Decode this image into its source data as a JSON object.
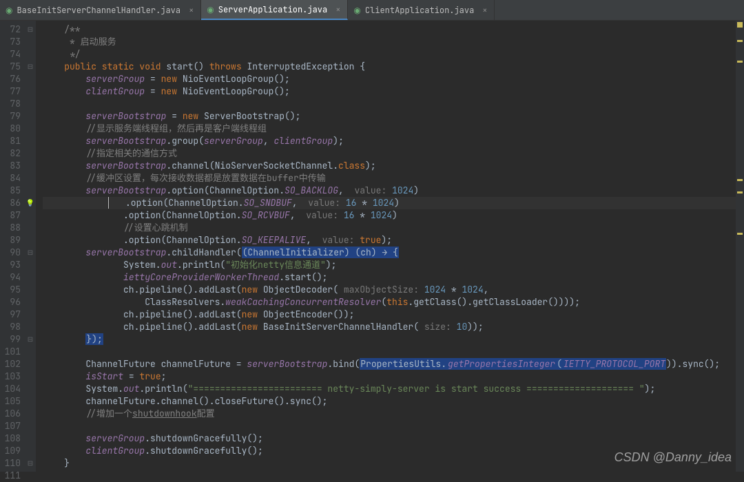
{
  "tabs": [
    {
      "label": "BaseInitServerChannelHandler.java",
      "active": false
    },
    {
      "label": "ServerApplication.java",
      "active": true
    },
    {
      "label": "ClientApplication.java",
      "active": false
    }
  ],
  "watermark": "CSDN @Danny_idea",
  "line_numbers": [
    "72",
    "73",
    "74",
    "75",
    "76",
    "77",
    "78",
    "79",
    "80",
    "81",
    "82",
    "83",
    "84",
    "85",
    "86",
    "87",
    "88",
    "89",
    "90",
    "93",
    "94",
    "95",
    "96",
    "97",
    "98",
    "99",
    "101",
    "102",
    "103",
    "104",
    "105",
    "106",
    "107",
    "108",
    "109",
    "110",
    "111"
  ],
  "current_line": "86",
  "code": {
    "l72": "/**",
    "l73": " * 启动服务",
    "l74": " */",
    "l75_kw1": "public static void",
    "l75_name": "start",
    "l75_throws": "throws",
    "l75_ex": "InterruptedException",
    "l76_field": "serverGroup",
    "l76_new": "new",
    "l76_ctor": "NioEventLoopGroup",
    "l77_field": "clientGroup",
    "l79_field": "serverBootstrap",
    "l79_ctor": "ServerBootstrap",
    "l80_cmt": "//显示服务端线程组，然后再是客户端线程组",
    "l81_call": ".group(",
    "l81_a": "serverGroup",
    "l81_b": "clientGroup",
    "l82_cmt": "//指定相关的通信方式",
    "l83_call": ".channel(NioServerSocketChannel.",
    "l83_kw": "class",
    "l84_cmt": "//缓冲区设置，每次接收数据都是放置数据在buffer中传输",
    "l85_call": ".option(ChannelOption.",
    "l85_c": "SO_BACKLOG",
    "l85_hint": "value:",
    "l85_val": "1024",
    "l86_c": "SO_SNDBUF",
    "l86_hint": "value:",
    "l86_v1": "16",
    "l86_v2": "1024",
    "l87_c": "SO_RCVBUF",
    "l88_cmt": "//设置心跳机制",
    "l89_c": "SO_KEEPALIVE",
    "l89_hint": "value:",
    "l89_val": "true",
    "l90_call": ".childHandler(",
    "l90_hl": "(ChannelInitializer) (ch) → {",
    "l93_sys": "System.",
    "l93_out": "out",
    "l93_pr": ".println(",
    "l93_str": "\"初始化netty信息通道\"",
    "l94_field": "iettyCoreProviderWorkerThread",
    "l94_call": ".start();",
    "l95_pre": "ch.pipeline().addLast(",
    "l95_new": "new",
    "l95_ctor": "ObjectDecoder",
    "l95_hint": "maxObjectSize:",
    "l95_v1": "1024",
    "l95_v2": "1024",
    "l96_pre": "ClassResolvers.",
    "l96_m": "weakCachingConcurrentResolver",
    "l96_this": "this",
    "l96_tail": ".getClass().getClassLoader())));",
    "l97_ctor": "ObjectEncoder",
    "l98_ctor": "BaseInitServerChannelHandler",
    "l98_hint": "size:",
    "l98_val": "10",
    "l99": "});",
    "l102_pre": "ChannelFuture channelFuture = ",
    "l102_field": "serverBootstrap",
    "l102_bind": ".bind(",
    "l102_hl1": "PropertiesUtils.",
    "l102_hl2": "getPropertiesInteger",
    "l102_hl3": "IETTY_PROTOCOL_PORT",
    "l102_tail": ")).sync();",
    "l103_field": "isStart",
    "l103_val": "true",
    "l104_str": "\"======================== netty-simply-server is start success ==================== \"",
    "l105": "channelFuture.channel().closeFuture().sync();",
    "l106_pre": "//增加一个",
    "l106_u": "shutdownhook",
    "l106_suf": "配置",
    "l108_field": "serverGroup",
    "l108_call": ".shutdownGracefully();",
    "l109_field": "clientGroup"
  }
}
